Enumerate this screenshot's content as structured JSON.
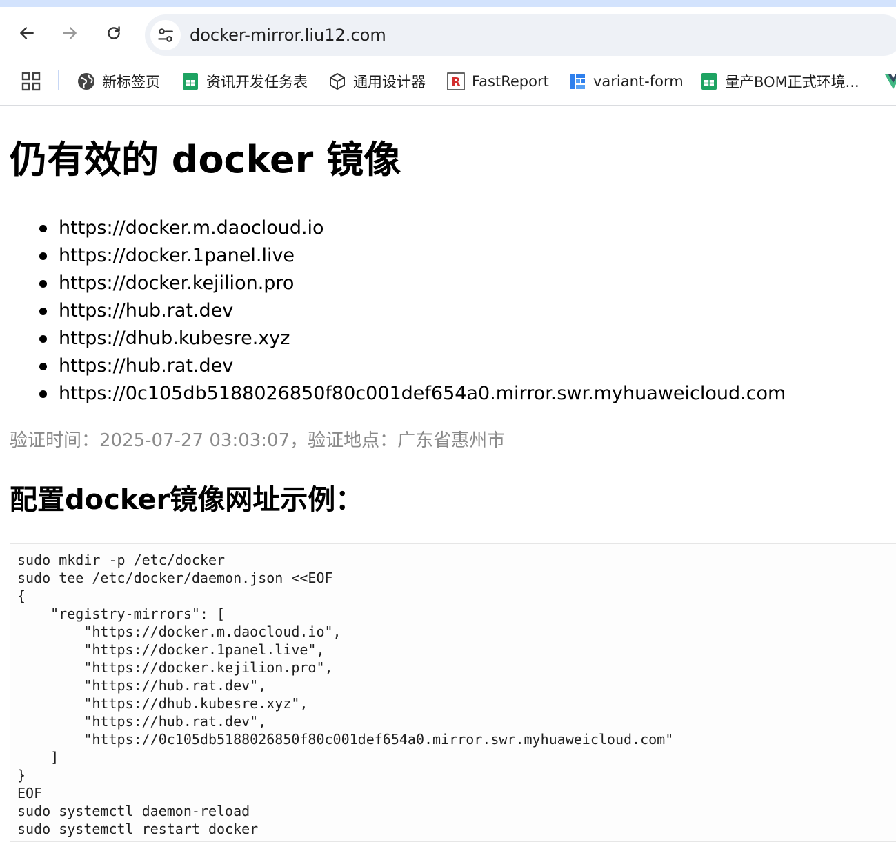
{
  "browser": {
    "url": "docker-mirror.liu12.com",
    "bookmarks": [
      {
        "label": "新标签页",
        "icon": "globe-icon"
      },
      {
        "label": "资讯开发任务表",
        "icon": "sheet-icon",
        "color": "#1ea362"
      },
      {
        "label": "通用设计器",
        "icon": "cube-icon"
      },
      {
        "label": "FastReport",
        "icon": "fastreport-icon",
        "color": "#d32f2f"
      },
      {
        "label": "variant-form",
        "icon": "form-icon",
        "color": "#2f80ed"
      },
      {
        "label": "量产BOM正式环境...",
        "icon": "sheet-icon",
        "color": "#1ea362"
      }
    ]
  },
  "page": {
    "title": "仍有效的 docker 镜像",
    "mirrors": [
      "https://docker.m.daocloud.io",
      "https://docker.1panel.live",
      "https://docker.kejilion.pro",
      "https://hub.rat.dev",
      "https://dhub.kubesre.xyz",
      "https://hub.rat.dev",
      "https://0c105db5188026850f80c001def654a0.mirror.swr.myhuaweicloud.com"
    ],
    "verify_text": "验证时间：2025-07-27 03:03:07，验证地点：广东省惠州市",
    "config_title": "配置docker镜像网址示例：",
    "code": "sudo mkdir -p /etc/docker\nsudo tee /etc/docker/daemon.json <<EOF\n{\n    \"registry-mirrors\": [\n        \"https://docker.m.daocloud.io\",\n        \"https://docker.1panel.live\",\n        \"https://docker.kejilion.pro\",\n        \"https://hub.rat.dev\",\n        \"https://dhub.kubesre.xyz\",\n        \"https://hub.rat.dev\",\n        \"https://0c105db5188026850f80c001def654a0.mirror.swr.myhuaweicloud.com\"\n    ]\n}\nEOF\nsudo systemctl daemon-reload\nsudo systemctl restart docker"
  }
}
